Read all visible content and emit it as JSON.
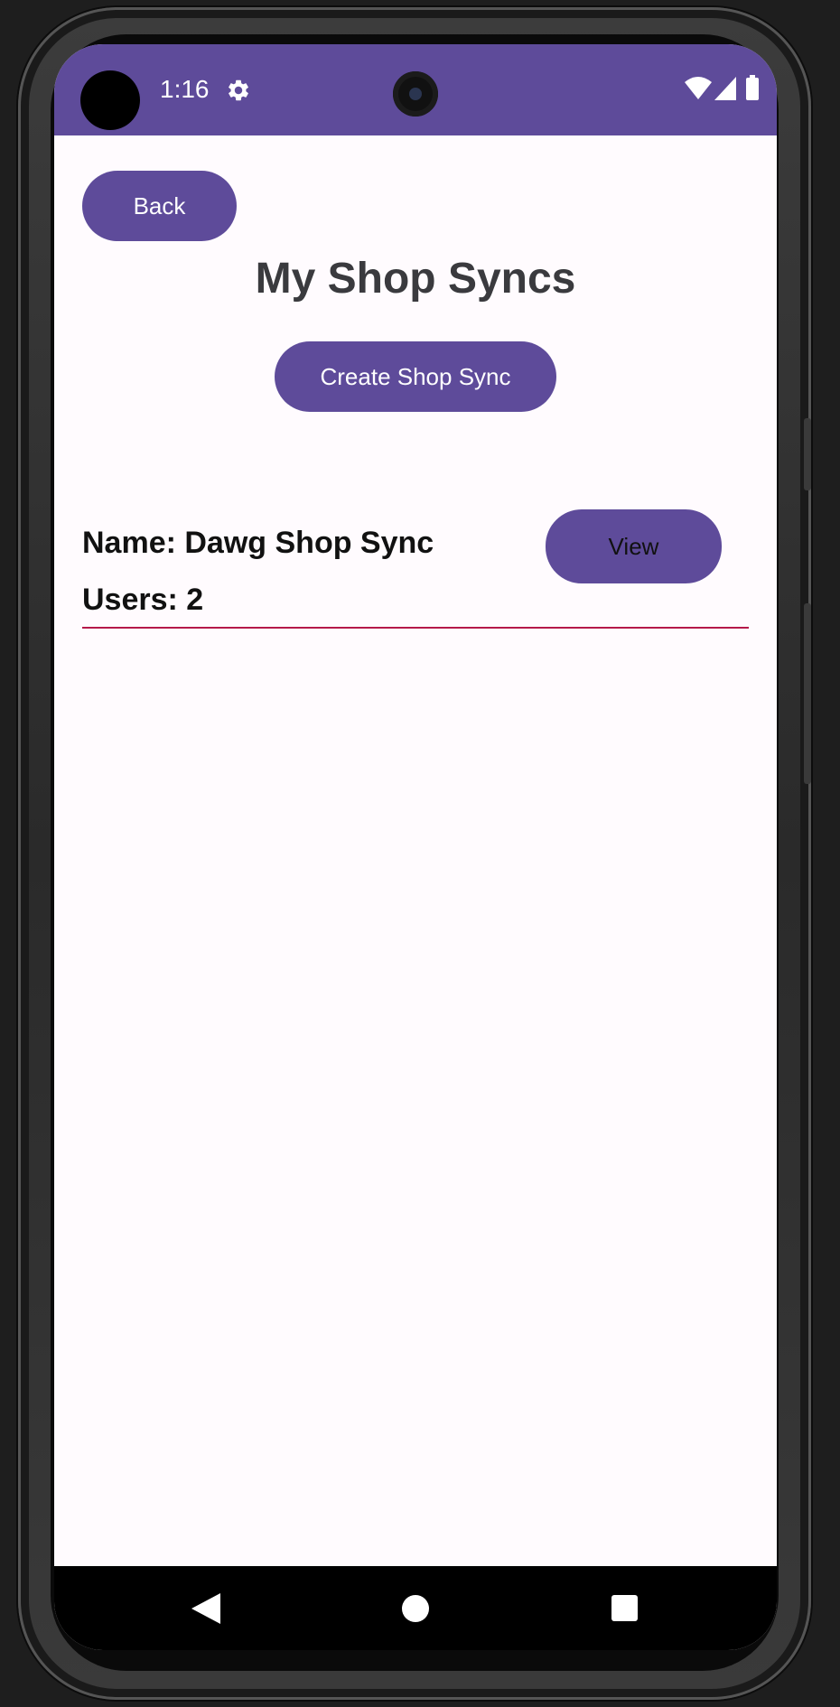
{
  "status_bar": {
    "time": "1:16",
    "background_color": "#5e4b9a",
    "icons": [
      "settings-icon",
      "wifi-icon",
      "cellular-signal-icon",
      "battery-icon"
    ]
  },
  "header": {
    "back_label": "Back",
    "title": "My Shop Syncs",
    "create_label": "Create Shop Sync"
  },
  "shop_syncs": [
    {
      "name_text": "Name: Dawg Shop Sync",
      "users_text": "Users: 2",
      "view_label": "View"
    }
  ],
  "colors": {
    "accent": "#5e4b9a",
    "divider": "#b5194a",
    "background": "#fffbfe"
  },
  "nav_bar": {
    "icons": [
      "nav-back-icon",
      "nav-home-icon",
      "nav-recents-icon"
    ]
  }
}
